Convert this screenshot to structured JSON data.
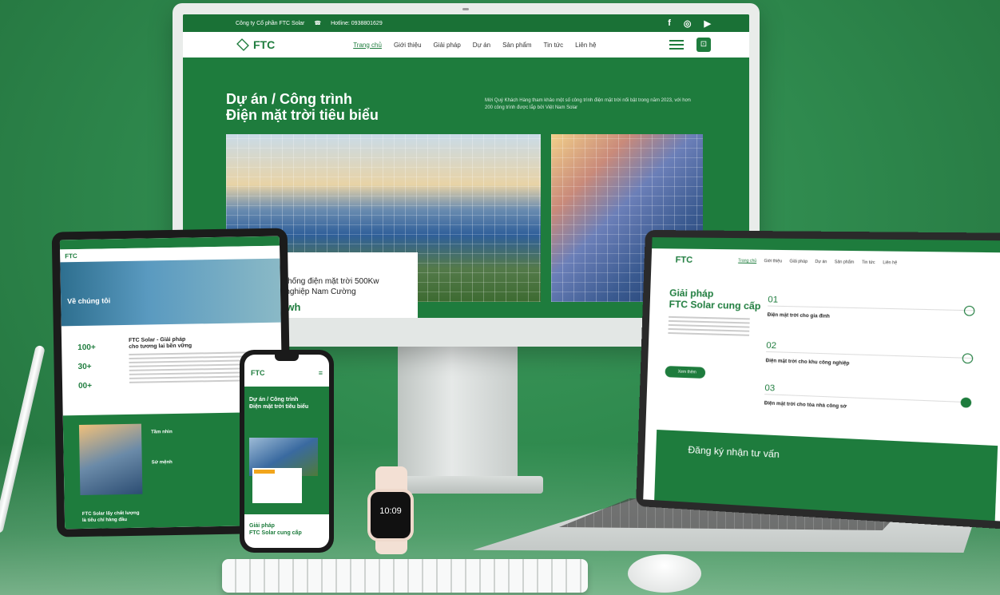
{
  "desktop": {
    "topbar": {
      "company": "Công ty Cổ phần FTC Solar",
      "hotline": "Hotline: 0938801629"
    },
    "logo_text": "FTC",
    "menu": [
      "Trang chủ",
      "Giới thiệu",
      "Giải pháp",
      "Dự án",
      "Sản phẩm",
      "Tin tức",
      "Liên hệ"
    ],
    "hero": {
      "title_line1": "Dự án / Công trình",
      "title_line2": "Điện mặt trời tiêu biểu",
      "description": "Mời Quý Khách Hàng tham khảo một số công trình điện mặt trời nổi bật trong năm 2023, với hơn 200 công trình được lắp bởi Việt Nam Solar"
    },
    "project_card": {
      "title_line1": "ệ thống điện mặt trời 500Kw",
      "title_line2": "h nghiệp Nam Cường",
      "value": "Kwh"
    }
  },
  "tablet": {
    "logo_text": "FTC",
    "hero_title": "Về chúng tôi",
    "stats": [
      "100+",
      "30+",
      "00+"
    ],
    "about_title": "FTC Solar - Giải pháp cho tương lai bền vững",
    "section1": "Tầm nhìn",
    "section2": "Sứ mệnh",
    "footer_line1": "FTC Solar lấy chất lượng",
    "footer_line2": "là tiêu chí hàng đầu"
  },
  "phone": {
    "logo_text": "FTC",
    "title_line1": "Dự án / Công trình",
    "title_line2": "Điện mặt trời tiêu biểu",
    "bottom_line1": "Giải pháp",
    "bottom_line2": "FTC Solar cung cấp"
  },
  "watch": {
    "time": "10:09"
  },
  "laptop": {
    "logo_text": "FTC",
    "menu": [
      "Trang chủ",
      "Giới thiệu",
      "Giải pháp",
      "Dự án",
      "Sản phẩm",
      "Tin tức",
      "Liên hệ"
    ],
    "heading_line1": "Giải pháp",
    "heading_line2": "FTC Solar cung cấp",
    "button": "Xem thêm",
    "steps": [
      {
        "num": "01",
        "label": "Điện mặt trời cho gia đình"
      },
      {
        "num": "02",
        "label": "Điện mặt trời cho khu công nghiệp"
      },
      {
        "num": "03",
        "label": "Điện mặt trời cho tòa nhà công sở"
      }
    ],
    "form_title": "Đăng ký nhận tư vấn"
  },
  "colors": {
    "brand_green": "#1e7c3d",
    "background_green": "#2f8a4e",
    "accent_orange": "#f2a51c"
  },
  "icons": [
    "facebook-icon",
    "instagram-icon",
    "youtube-icon",
    "phone-icon",
    "menu-icon",
    "cart-icon",
    "arrow-right-icon"
  ]
}
